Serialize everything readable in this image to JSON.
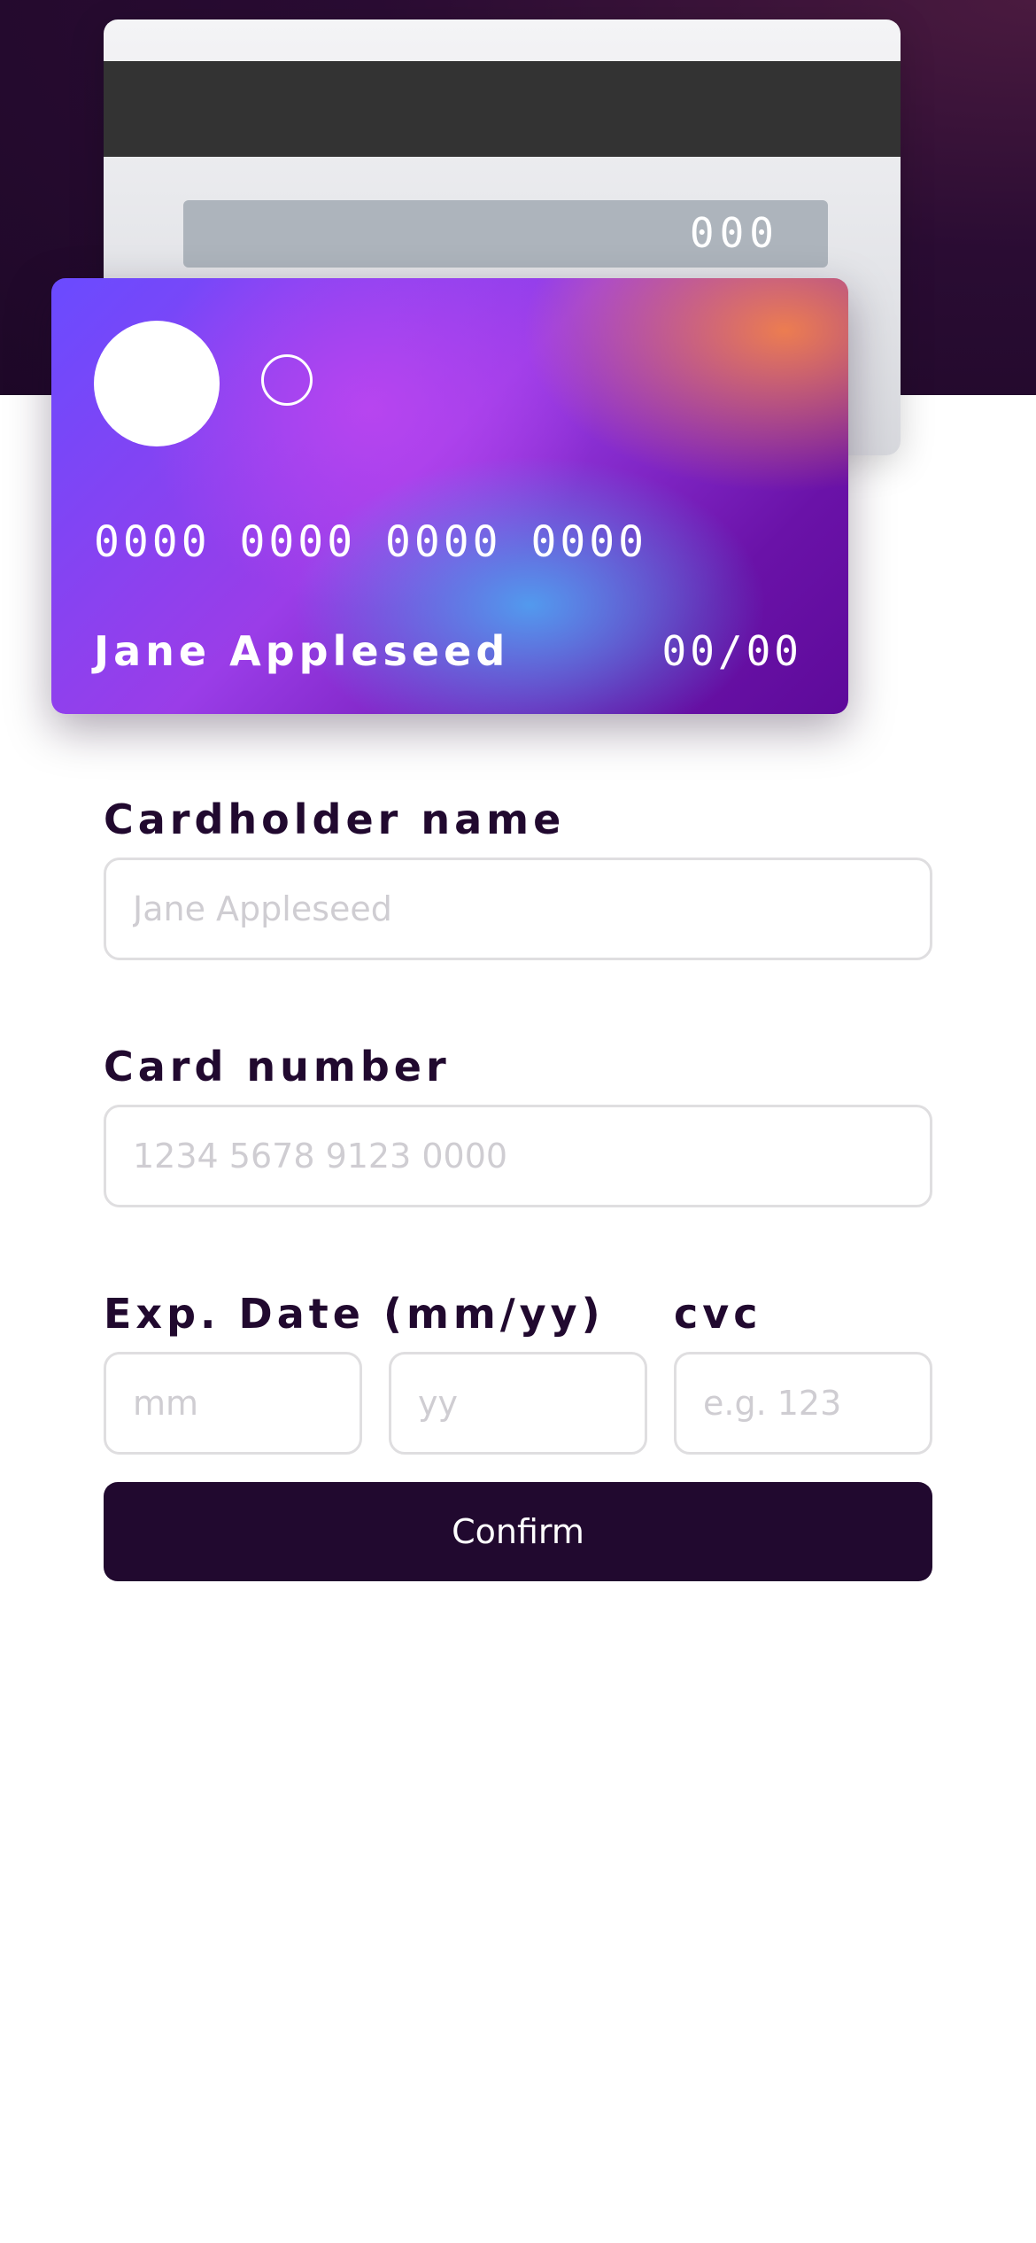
{
  "card": {
    "back": {
      "cvc": "000"
    },
    "front": {
      "number": "0000 0000 0000 0000",
      "holder_name": "Jane Appleseed",
      "expiry": "00/00"
    }
  },
  "form": {
    "cardholder": {
      "label": "Cardholder name",
      "placeholder": "Jane Appleseed"
    },
    "card_number": {
      "label": "Card number",
      "placeholder": "1234 5678 9123 0000"
    },
    "exp_date": {
      "label": "Exp. Date (mm/yy)",
      "month_placeholder": "mm",
      "year_placeholder": "yy"
    },
    "cvc": {
      "label": "cvc",
      "placeholder": "e.g. 123"
    },
    "confirm_label": "Confirm"
  },
  "colors": {
    "dark_violet": "#21092f",
    "input_border": "#dfdee0",
    "placeholder": "#cfcdd2",
    "background": "#ffffff"
  }
}
